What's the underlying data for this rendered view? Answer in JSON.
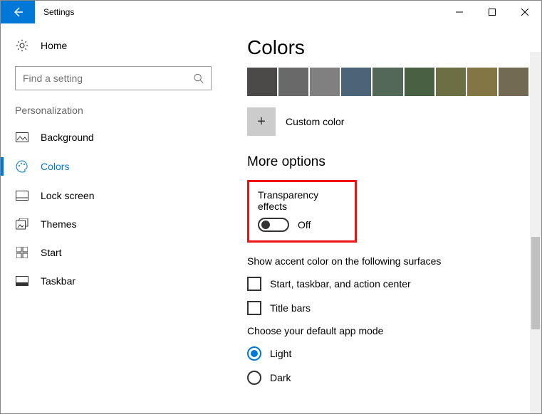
{
  "window": {
    "title": "Settings"
  },
  "sidebar": {
    "home_label": "Home",
    "search_placeholder": "Find a setting",
    "section_label": "Personalization",
    "items": [
      {
        "label": "Background"
      },
      {
        "label": "Colors"
      },
      {
        "label": "Lock screen"
      },
      {
        "label": "Themes"
      },
      {
        "label": "Start"
      },
      {
        "label": "Taskbar"
      }
    ]
  },
  "main": {
    "title": "Colors",
    "swatches": [
      "#4c4a48",
      "#696969",
      "#808080",
      "#4b6477",
      "#536857",
      "#496043",
      "#6c6e44",
      "#847545",
      "#726a53"
    ],
    "custom_label": "Custom color",
    "more_options": "More options",
    "transparency": {
      "label": "Transparency effects",
      "state": "Off"
    },
    "accent_surfaces_label": "Show accent color on the following surfaces",
    "checks": [
      {
        "label": "Start, taskbar, and action center"
      },
      {
        "label": "Title bars"
      }
    ],
    "app_mode_label": "Choose your default app mode",
    "radios": [
      {
        "label": "Light",
        "selected": true
      },
      {
        "label": "Dark",
        "selected": false
      }
    ]
  }
}
